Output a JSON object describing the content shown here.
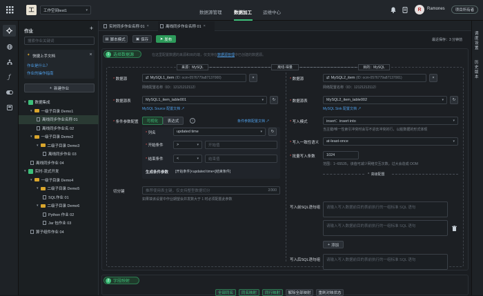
{
  "header": {
    "logo_letter": "工",
    "workspace": "工作空间test1",
    "nav": [
      "数据源管理",
      "数据加工",
      "运维中心"
    ],
    "active_nav": 1,
    "user": "Ramones",
    "user_initial": "R",
    "user_badge": "项目所有者"
  },
  "sidebar": {
    "title": "作业",
    "search_placeholder": "搜索作业关键词",
    "quick_title": "快捷上手文档",
    "quick_links": [
      "作业是什么？",
      "作业的操作指南"
    ],
    "new_job": "新建作业",
    "tree": [
      {
        "label": "数据集成",
        "level": 0,
        "kind": "root"
      },
      {
        "label": "一级子目录 Demo1",
        "level": 1,
        "kind": "folder"
      },
      {
        "label": "离线同步作业名称 01",
        "level": 2,
        "kind": "file",
        "selected": true
      },
      {
        "label": "离线同步作业名 02",
        "level": 2,
        "kind": "file"
      },
      {
        "label": "一级子目录 Demo2",
        "level": 1,
        "kind": "folder"
      },
      {
        "label": "二级子目录 Demo3",
        "level": 2,
        "kind": "folder"
      },
      {
        "label": "离线同步作业 03",
        "level": 3,
        "kind": "file"
      },
      {
        "label": "离线同步作业 04",
        "level": 1,
        "kind": "file"
      },
      {
        "label": "实时-流式开发",
        "level": 0,
        "kind": "root"
      },
      {
        "label": "一级子目录 Demo4",
        "level": 1,
        "kind": "folder"
      },
      {
        "label": "二级子目录 Demo5",
        "level": 2,
        "kind": "folder"
      },
      {
        "label": "SQL作业 01",
        "level": 3,
        "kind": "file"
      },
      {
        "label": "二级子目录 Demo6",
        "level": 2,
        "kind": "folder"
      },
      {
        "label": "Python 作业 02",
        "level": 3,
        "kind": "file"
      },
      {
        "label": "Jar 包作业 03",
        "level": 3,
        "kind": "file"
      },
      {
        "label": "算子组件作业 04",
        "level": 1,
        "kind": "file"
      }
    ]
  },
  "tabs": [
    "实时同步作业名称 01",
    "离线同步作业名称 01"
  ],
  "toolbar": {
    "script_mode": "脚本模式",
    "save": "保存",
    "publish": "发布",
    "last_saved": "最近保存：3 分钟前"
  },
  "step1": {
    "num": "1",
    "title": "选择数据源",
    "hint": "在这里配置数据的来源和目的端，仅支持在",
    "hint_link": "数据源管理",
    "hint_tail": "中已创建的数据源。"
  },
  "flow": {
    "source": "来源：MySQL",
    "mid": "离线-得量",
    "target": "目的：MySQL"
  },
  "source": {
    "datasource_label": "数据源",
    "datasource_value": "MySQL1_item",
    "datasource_id": "(ID: ocm-0576779a87137000)",
    "net_label": "网络配置名称（ID：12121212112）",
    "table_label": "数据源表",
    "table_value": "MySQL1_item_table001",
    "table_link": "MySQL Source 配置文档",
    "cond_label": "条件参数配置",
    "mode_visual": "可视化",
    "mode_expr": "表达式",
    "cond_link": "条件参数配置文档",
    "col_label": "列名",
    "col_value": "updated time",
    "start_label": "开始条件",
    "start_op": ">",
    "start_ph": "开始值",
    "end_label": "结束条件",
    "end_op": "<",
    "end_ph": "结束值",
    "gen_label": "生成条件参数",
    "gen_value": "[开始条件]<updated time<[结束条件]",
    "split_label": "切分键",
    "split_ph": "推荐使用表主键，仅支持整型数据切分",
    "split_count": "2/300",
    "split_hint": "如果填该设置中作业期望会并发数大于 1 时必须配置此参数"
  },
  "target": {
    "datasource_label": "数据源",
    "datasource_value": "MySQL2_item",
    "datasource_id": "(ID: ocm-0576779a87137001)",
    "net_label": "网络配置名称（ID：12121212112）",
    "table_label": "数据源表",
    "table_value": "MySQL2_item_table002",
    "table_link": "MySQL Sink 配置文档",
    "write_mode_label": "写入模式",
    "write_mode_value": "insert：insert into",
    "write_mode_hint": "当主键/唯一性索引冲突时会写不进去冲突的行，以脏数据的形式体现",
    "consistency_label": "写入一致性语义",
    "consistency_value": "at-least-once",
    "batch_label": "批量写入条数",
    "batch_value": "1024",
    "batch_hint": "范围：1~65535，该值可减少网络交互次数，过大会造成 OOM",
    "advanced": "高级配置",
    "pre_sql_label": "写入前SQL语句组",
    "post_sql_label": "写入后SQL语句组",
    "sql_ph": "请输入写入数据前目的表前执行的一组标准 SQL 语句",
    "add": "添加"
  },
  "step2": {
    "num": "2",
    "title": "字段映射",
    "actions": [
      "全部同名",
      "同名映射",
      "同行映射",
      "解除全部映射",
      "重刷对映状态"
    ]
  },
  "right_rail": [
    "调度设置",
    "历史版本"
  ],
  "colors": {
    "accent": "#3ec07a",
    "link": "#4f9fe8",
    "folder": "#d9a62d"
  }
}
